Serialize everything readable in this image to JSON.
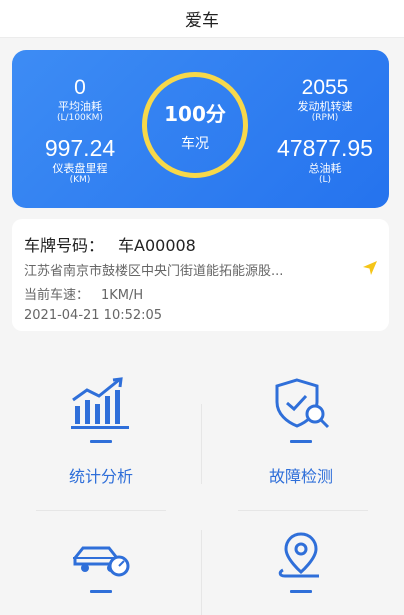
{
  "header": {
    "title": "爱车"
  },
  "stats": {
    "avg_fuel": {
      "value": "0",
      "label": "平均油耗",
      "unit": "(L/100KM)"
    },
    "odometer": {
      "value": "997.24",
      "label": "仪表盘里程",
      "unit": "(KM)"
    },
    "rpm": {
      "value": "2055",
      "label": "发动机转速",
      "unit": "(RPM)"
    },
    "total_fuel": {
      "value": "47877.95",
      "label": "总油耗",
      "unit": "(L)"
    },
    "score": {
      "value": "100分",
      "label": "车况"
    }
  },
  "vehicle": {
    "plate_label": "车牌号码：",
    "plate_value": "车A00008",
    "address": "江苏省南京市鼓楼区中央门街道能拓能源股...",
    "speed_label": "当前车速：",
    "speed_value": "1KM/H",
    "timestamp": "2021-04-21 10:52:05"
  },
  "menu": {
    "stats_label": "统计分析",
    "fault_label": "故障检测"
  },
  "colors": {
    "accent": "#2f6fd9",
    "card": "#2f7bf0",
    "ring": "#f7d84a",
    "nav": "#f5c518"
  }
}
